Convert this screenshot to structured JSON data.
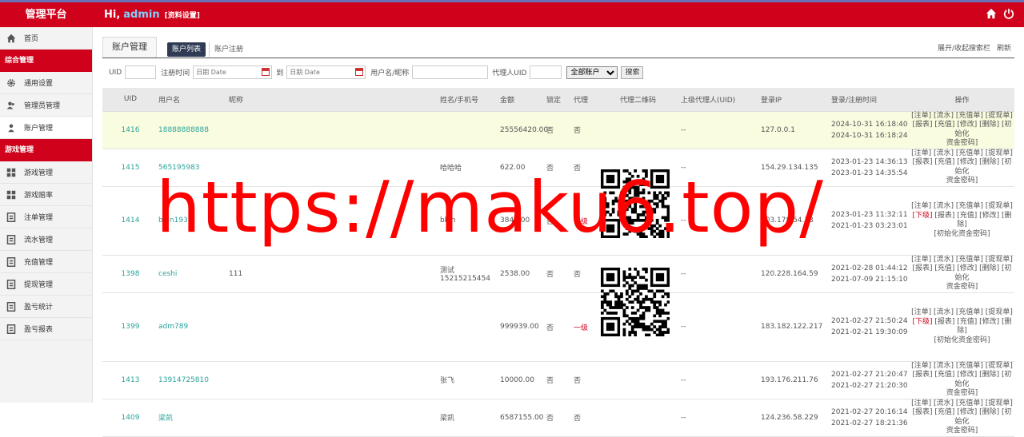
{
  "header": {
    "brand": "管理平台",
    "greeting": "Hi,",
    "username": "admin",
    "profile_link": "[资料设置]",
    "home_icon": "home-icon",
    "power_icon": "power-icon"
  },
  "sidebar": {
    "home": "首页",
    "section1": "综合管理",
    "items1": [
      "通用设置",
      "管理员管理",
      "账户管理"
    ],
    "section2": "游戏管理",
    "items2": [
      "游戏管理",
      "游戏赔率",
      "注单管理",
      "流水管理",
      "充值管理",
      "提现管理",
      "盈亏统计",
      "盈亏报表"
    ]
  },
  "tabs": {
    "main": "账户管理",
    "list": "账户列表",
    "register": "账户注册",
    "toggle": "展开/收起搜索栏",
    "refresh": "刷新"
  },
  "search": {
    "uid_label": "UID",
    "time_label": "注册时间",
    "date_placeholder": "日期 Date",
    "to_label": "到",
    "name_label": "用户名/昵称",
    "agent_label": "代理人UID",
    "select_value": "全部账户",
    "button": "搜索"
  },
  "table": {
    "headers": [
      "UID",
      "用户名",
      "昵称",
      "姓名/手机号",
      "金额",
      "锁定",
      "代理",
      "代理二维码",
      "上级代理人(UID)",
      "登录IP",
      "登录/注册时间",
      "操作"
    ],
    "rows": [
      {
        "uid": "1416",
        "username": "18888888888",
        "nick": "",
        "name": "",
        "phone": "",
        "amount": "25556420.00",
        "lock": "否",
        "agent": "否",
        "parent": "--",
        "ip": "127.0.0.1",
        "login": "2024-10-31 16:18:40",
        "reg": "2024-10-31 16:18:24",
        "ops1": "[注单] [流水] [充值单] [提现单]",
        "ops2": "[报表] [充值] [修改] [删除] [初始化",
        "ops3": "资金密码]"
      },
      {
        "uid": "1415",
        "username": "565195983",
        "nick": "",
        "name": "哈哈哈",
        "phone": "",
        "amount": "622.00",
        "lock": "否",
        "agent": "否",
        "parent": "--",
        "ip": "154.29.134.135",
        "login": "2023-01-23 14:36:13",
        "reg": "2023-01-23 14:35:54",
        "ops1": "[注单] [流水] [充值单] [提现单]",
        "ops2": "[报表] [充值] [修改] [删除] [初始化",
        "ops3": "资金密码]"
      },
      {
        "uid": "1414",
        "username": "bbin1937",
        "nick": "",
        "name": "bbin",
        "phone": "",
        "amount": "3847.00",
        "lock": "否",
        "agent": "一级",
        "parent": "--",
        "ip": "103.178.54.23",
        "login": "2023-01-23 11:32:11",
        "reg": "2021-01-23 03:23:01",
        "ops1": "[注单] [流水] [充值单] [提现单]",
        "ops_red": "[下级]",
        "ops2": " [报表] [充值] [修改] [删除]",
        "ops3": "[初始化资金密码]"
      },
      {
        "uid": "1398",
        "username": "ceshi",
        "nick": "111",
        "name": "测试",
        "phone": "15215215454",
        "amount": "2538.00",
        "lock": "否",
        "agent": "否",
        "parent": "--",
        "ip": "120.228.164.59",
        "login": "2021-02-28 01:44:12",
        "reg": "2021-07-09 21:15:10",
        "ops1": "[注单] [流水] [充值单] [提现单]",
        "ops2": "[报表] [充值] [修改] [删除] [初始化",
        "ops3": "资金密码]"
      },
      {
        "uid": "1399",
        "username": "adm789",
        "nick": "",
        "name": "",
        "phone": "",
        "amount": "999939.00",
        "lock": "否",
        "agent": "一级",
        "parent": "--",
        "ip": "183.182.122.217",
        "login": "2021-02-27 21:50:24",
        "reg": "2021-02-21 19:30:09",
        "ops1": "[注单] [流水] [充值单] [提现单]",
        "ops_red": "[下级]",
        "ops2": " [报表] [充值] [修改] [删除]",
        "ops3": "[初始化资金密码]"
      },
      {
        "uid": "1413",
        "username": "13914725810",
        "nick": "",
        "name": "张飞",
        "phone": "",
        "amount": "10000.00",
        "lock": "否",
        "agent": "否",
        "parent": "--",
        "ip": "193.176.211.76",
        "login": "2021-02-27 21:20:47",
        "reg": "2021-02-27 21:20:30",
        "ops1": "[注单] [流水] [充值单] [提现单]",
        "ops2": "[报表] [充值] [修改] [删除] [初始化",
        "ops3": "资金密码]"
      },
      {
        "uid": "1409",
        "username": "梁凯",
        "nick": "",
        "name": "梁凯",
        "phone": "",
        "amount": "6587155.00",
        "lock": "否",
        "agent": "否",
        "parent": "--",
        "ip": "124.236.58.229",
        "login": "2021-02-27 20:16:14",
        "reg": "2021-02-27 18:21:36",
        "ops1": "[注单] [流水] [充值单] [提现单]",
        "ops2": "[报表] [充值] [修改] [删除] [初始化",
        "ops3": "资金密码]"
      }
    ]
  },
  "watermark": "https://maku6.top/",
  "colors": {
    "brand_red": "#d0021b",
    "link_teal": "#2aa39a",
    "tab_dark": "#2f3b55"
  }
}
